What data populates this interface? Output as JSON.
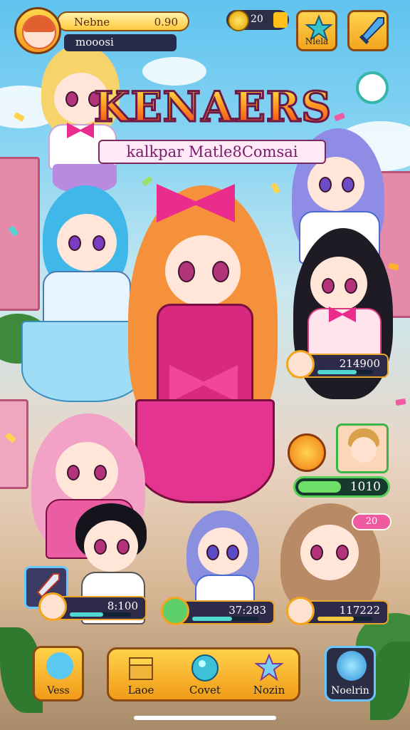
{
  "profile": {
    "name": "Nebne",
    "value": "0.90",
    "subtitle": "mooosi"
  },
  "currency": {
    "gold": "20"
  },
  "buttons": {
    "map": "Nlela"
  },
  "title": {
    "main": "KENAERS",
    "sub": "kalkpar Matle8Comsai"
  },
  "scores": [
    {
      "value": "214900"
    },
    {
      "value": "1010"
    },
    {
      "value": "20"
    },
    {
      "value": "8:100"
    },
    {
      "value": "37:283"
    },
    {
      "value": "117222"
    }
  ],
  "nav": {
    "left": "Vess",
    "items": [
      "Laoe",
      "Covet",
      "Nozin"
    ],
    "right": "Noelrin"
  }
}
